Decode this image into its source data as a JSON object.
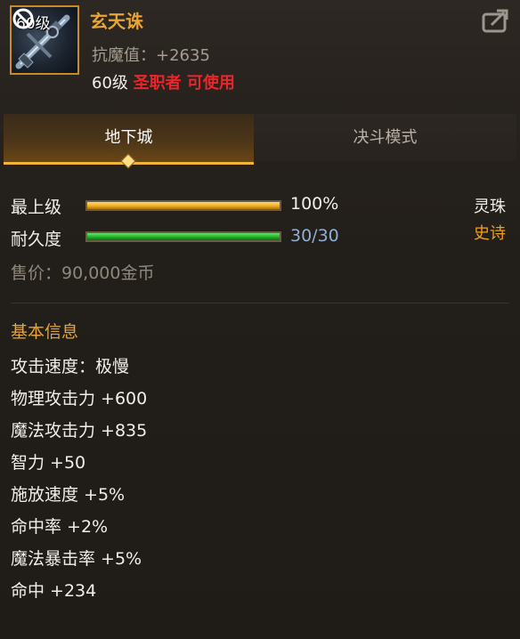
{
  "item": {
    "level_badge": "60级",
    "name": "玄天诛",
    "resist": "抗魔值：+2635",
    "req_level": "60级",
    "req_class": "圣职者 可使用",
    "icon": "gun-weapon-icon"
  },
  "tabs": [
    {
      "label": "地下城",
      "active": true
    },
    {
      "label": "决斗模式",
      "active": false
    }
  ],
  "stats": {
    "grade": {
      "label": "最上级",
      "value": "100%",
      "fill": 1.0,
      "color": "#f0b52a"
    },
    "durability": {
      "label": "耐久度",
      "value": "30/30",
      "fill": 1.0,
      "color": "#24b52c"
    }
  },
  "tags": {
    "slot": "灵珠",
    "rarity": "史诗"
  },
  "price": "售价：90,000金币",
  "basic_info": {
    "title": "基本信息",
    "attributes": [
      "攻击速度：极慢",
      "物理攻击力 +600",
      "魔法攻击力 +835",
      "智力 +50",
      "施放速度 +5%",
      "命中率 +2%",
      "魔法暴击率 +5%",
      "命中 +234"
    ]
  },
  "colors": {
    "accent": "#e8a534",
    "rarity_epic": "#f0a020",
    "class_restrict": "#e8262b"
  }
}
